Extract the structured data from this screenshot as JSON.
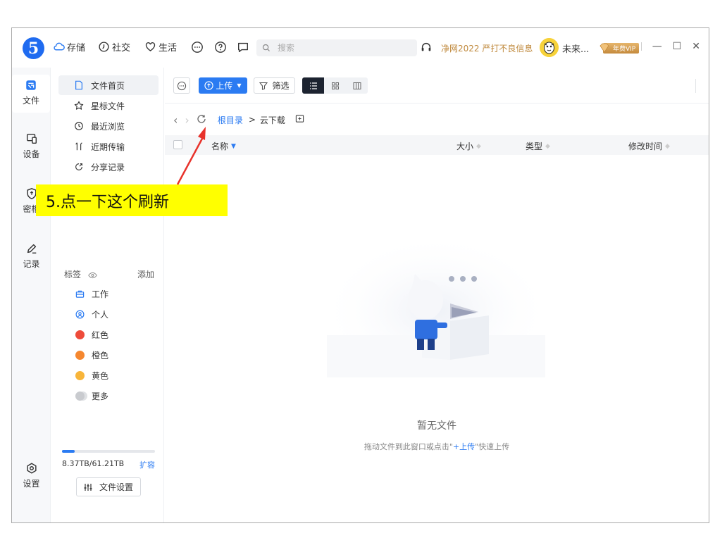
{
  "titlebar": {
    "logo_text": "5",
    "nav": [
      {
        "label": "存储",
        "icon": "cloud-icon"
      },
      {
        "label": "社交",
        "icon": "clock-icon"
      },
      {
        "label": "生活",
        "icon": "heart-icon"
      }
    ],
    "search_placeholder": "搜索",
    "promo_text": "净网2022 严打不良信息",
    "username": "未来...",
    "vip_label": "年费VIP"
  },
  "rail": {
    "items": [
      {
        "label": "文件",
        "icon": "file-icon"
      },
      {
        "label": "设备",
        "icon": "device-icon"
      },
      {
        "label": "密柜",
        "icon": "shield-icon"
      },
      {
        "label": "记录",
        "icon": "pen-icon"
      },
      {
        "label": "设置",
        "icon": "settings-icon"
      }
    ]
  },
  "side": {
    "items": [
      {
        "label": "文件首页",
        "icon": "doc-icon"
      },
      {
        "label": "星标文件",
        "icon": "star-icon"
      },
      {
        "label": "最近浏览",
        "icon": "history-icon"
      },
      {
        "label": "近期传输",
        "icon": "transfer-icon"
      },
      {
        "label": "分享记录",
        "icon": "share-icon"
      }
    ],
    "tags_title": "标签",
    "tags_add": "添加",
    "tags": [
      {
        "label": "工作",
        "icon": "briefcase-icon"
      },
      {
        "label": "个人",
        "icon": "person-icon"
      },
      {
        "label": "红色",
        "color": "#ee4b3a"
      },
      {
        "label": "橙色",
        "color": "#f5872f"
      },
      {
        "label": "黄色",
        "color": "#f8b53a"
      },
      {
        "label": "更多",
        "color": "#c9cbcf"
      }
    ],
    "storage_text": "8.37TB/61.21TB",
    "storage_fraction": 0.137,
    "expand_label": "扩容",
    "file_settings_label": "文件设置"
  },
  "main": {
    "upload_label": "上传",
    "filter_label": "筛选",
    "breadcrumb_root": "根目录",
    "breadcrumb_sep": ">",
    "breadcrumb_current": "云下载",
    "columns": {
      "name": "名称",
      "size": "大小",
      "type": "类型",
      "modified": "修改时间"
    },
    "empty_title": "暂无文件",
    "empty_hint_prefix": "拖动文件到此窗口或点击\"",
    "empty_hint_link": "+上传",
    "empty_hint_suffix": "\"快速上传"
  },
  "annotation": {
    "text": "5.点一下这个刷新"
  },
  "colors": {
    "accent": "#2b7bf2",
    "callout_bg": "#ffff00",
    "arrow": "#e8322b"
  }
}
